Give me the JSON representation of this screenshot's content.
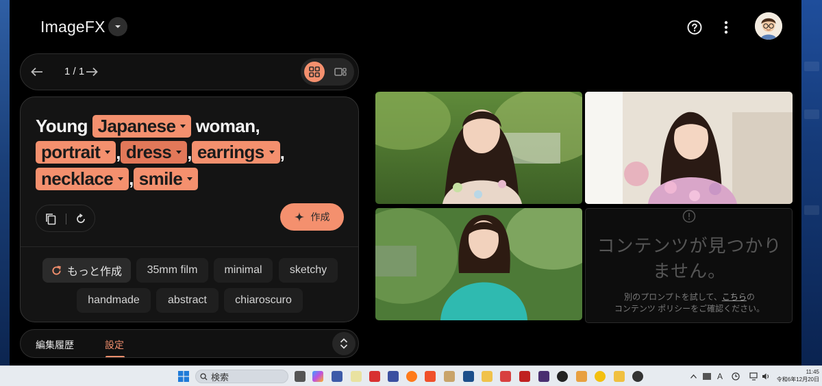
{
  "app": {
    "name": "ImageFX"
  },
  "pager": {
    "label": "1 / 1"
  },
  "prompt": {
    "segments": [
      {
        "type": "text",
        "value": "Young "
      },
      {
        "type": "chip",
        "value": "Japanese",
        "shade": "normal"
      },
      {
        "type": "text",
        "value": " woman,"
      },
      {
        "type": "break"
      },
      {
        "type": "chip",
        "value": "portrait",
        "shade": "normal"
      },
      {
        "type": "text",
        "value": ","
      },
      {
        "type": "chip",
        "value": "dress",
        "shade": "dark"
      },
      {
        "type": "text",
        "value": ","
      },
      {
        "type": "chip",
        "value": "earrings",
        "shade": "normal"
      },
      {
        "type": "text",
        "value": ","
      },
      {
        "type": "break"
      },
      {
        "type": "chip",
        "value": "necklace",
        "shade": "normal"
      },
      {
        "type": "text",
        "value": ","
      },
      {
        "type": "chip",
        "value": "smile",
        "shade": "normal"
      }
    ]
  },
  "create_button": {
    "label": "作成"
  },
  "suggestions": {
    "more_label": "もっと作成",
    "chips": [
      "35mm film",
      "minimal",
      "sketchy",
      "handmade",
      "abstract",
      "chiaroscuro"
    ]
  },
  "bottom_tabs": {
    "history": "編集履歴",
    "settings": "設定"
  },
  "results": {
    "empty_title": "コンテンツが見つかりません。",
    "empty_line1": "別のプロンプトを試して、",
    "empty_link": "こちら",
    "empty_line1_end": "の",
    "empty_line2": "コンテンツ ポリシーをご確認ください。"
  },
  "taskbar": {
    "search_placeholder": "検索",
    "tray_ime": "A",
    "clock_time": "11:45",
    "clock_date": "令和6年12月20日"
  },
  "colors": {
    "accent": "#f4906e",
    "accent_dark": "#e27859",
    "background": "#000000",
    "card": "#141414"
  },
  "icons": [
    "chevron-down-icon",
    "help-icon",
    "more-vert-icon",
    "arrow-left-icon",
    "arrow-right-icon",
    "grid-view-icon",
    "single-view-icon",
    "copy-icon",
    "reset-icon",
    "sparkle-icon",
    "refresh-icon",
    "unfold-icon",
    "info-icon",
    "windows-start-icon",
    "search-icon"
  ]
}
